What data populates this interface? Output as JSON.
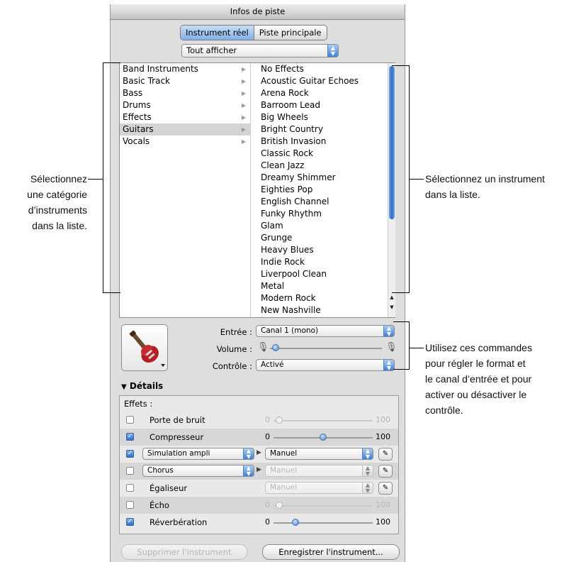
{
  "window": {
    "title": "Infos de piste"
  },
  "segmented": {
    "options": [
      "Instrument réel",
      "Piste principale"
    ],
    "selected": "Instrument réel"
  },
  "filter_popup": {
    "value": "Tout afficher"
  },
  "categories": [
    {
      "label": "Band Instruments"
    },
    {
      "label": "Basic Track"
    },
    {
      "label": "Bass"
    },
    {
      "label": "Drums"
    },
    {
      "label": "Effects"
    },
    {
      "label": "Guitars",
      "selected": true
    },
    {
      "label": "Vocals"
    }
  ],
  "instruments": [
    "No Effects",
    "Acoustic Guitar Echoes",
    "Arena Rock",
    "Barroom Lead",
    "Big Wheels",
    "Bright Country",
    "British Invasion",
    "Classic Rock",
    "Clean Jazz",
    "Dreamy Shimmer",
    "Eighties Pop",
    "English Channel",
    "Funky Rhythm",
    "Glam",
    "Grunge",
    "Heavy Blues",
    "Indie Rock",
    "Liverpool Clean",
    "Metal",
    "Modern Rock",
    "New Nashville"
  ],
  "controls": {
    "input_label": "Entrée :",
    "input_value": "Canal 1 (mono)",
    "volume_label": "Volume :",
    "volume_level": 0.02,
    "monitor_label": "Contrôle :",
    "monitor_value": "Activé"
  },
  "details": {
    "header": "Détails",
    "effects_label": "Effets :",
    "rows": [
      {
        "name": "Porte de bruit",
        "checked": false,
        "type": "slider",
        "min": "0",
        "max": "100",
        "level": 0.02,
        "disabled": true
      },
      {
        "name": "Compresseur",
        "checked": true,
        "type": "slider",
        "min": "0",
        "max": "100",
        "level": 0.5,
        "disabled": false
      },
      {
        "name": "Simulation ampli",
        "checked": true,
        "type": "popup",
        "preset": "Manuel",
        "disabled": false
      },
      {
        "name": "Chorus",
        "checked": false,
        "type": "popup",
        "preset": "Manuel",
        "disabled": true
      },
      {
        "name": "Égaliseur",
        "checked": false,
        "type": "preset",
        "preset": "Manuel",
        "disabled": true
      },
      {
        "name": "Écho",
        "checked": false,
        "type": "slider",
        "min": "0",
        "max": "100",
        "level": 0.02,
        "disabled": true
      },
      {
        "name": "Réverbération",
        "checked": true,
        "type": "slider",
        "min": "0",
        "max": "100",
        "level": 0.2,
        "disabled": false
      }
    ]
  },
  "buttons": {
    "delete": "Supprimer l'instrument",
    "save": "Enregistrer l'instrument..."
  },
  "annotations": {
    "left": "Sélectionnez\nune catégorie\nd’instruments\ndans la liste.",
    "right_top": "Sélectionnez un instrument\ndans la liste.",
    "right_bottom": "Utilisez ces commandes\npour régler le format et\nle canal d’entrée et pour\nactiver ou désactiver le\ncontrôle."
  },
  "colors": {
    "accent": "#3d82d9",
    "panel": "#dedede"
  },
  "icons": {
    "instrument": "electric-guitar-icon"
  }
}
